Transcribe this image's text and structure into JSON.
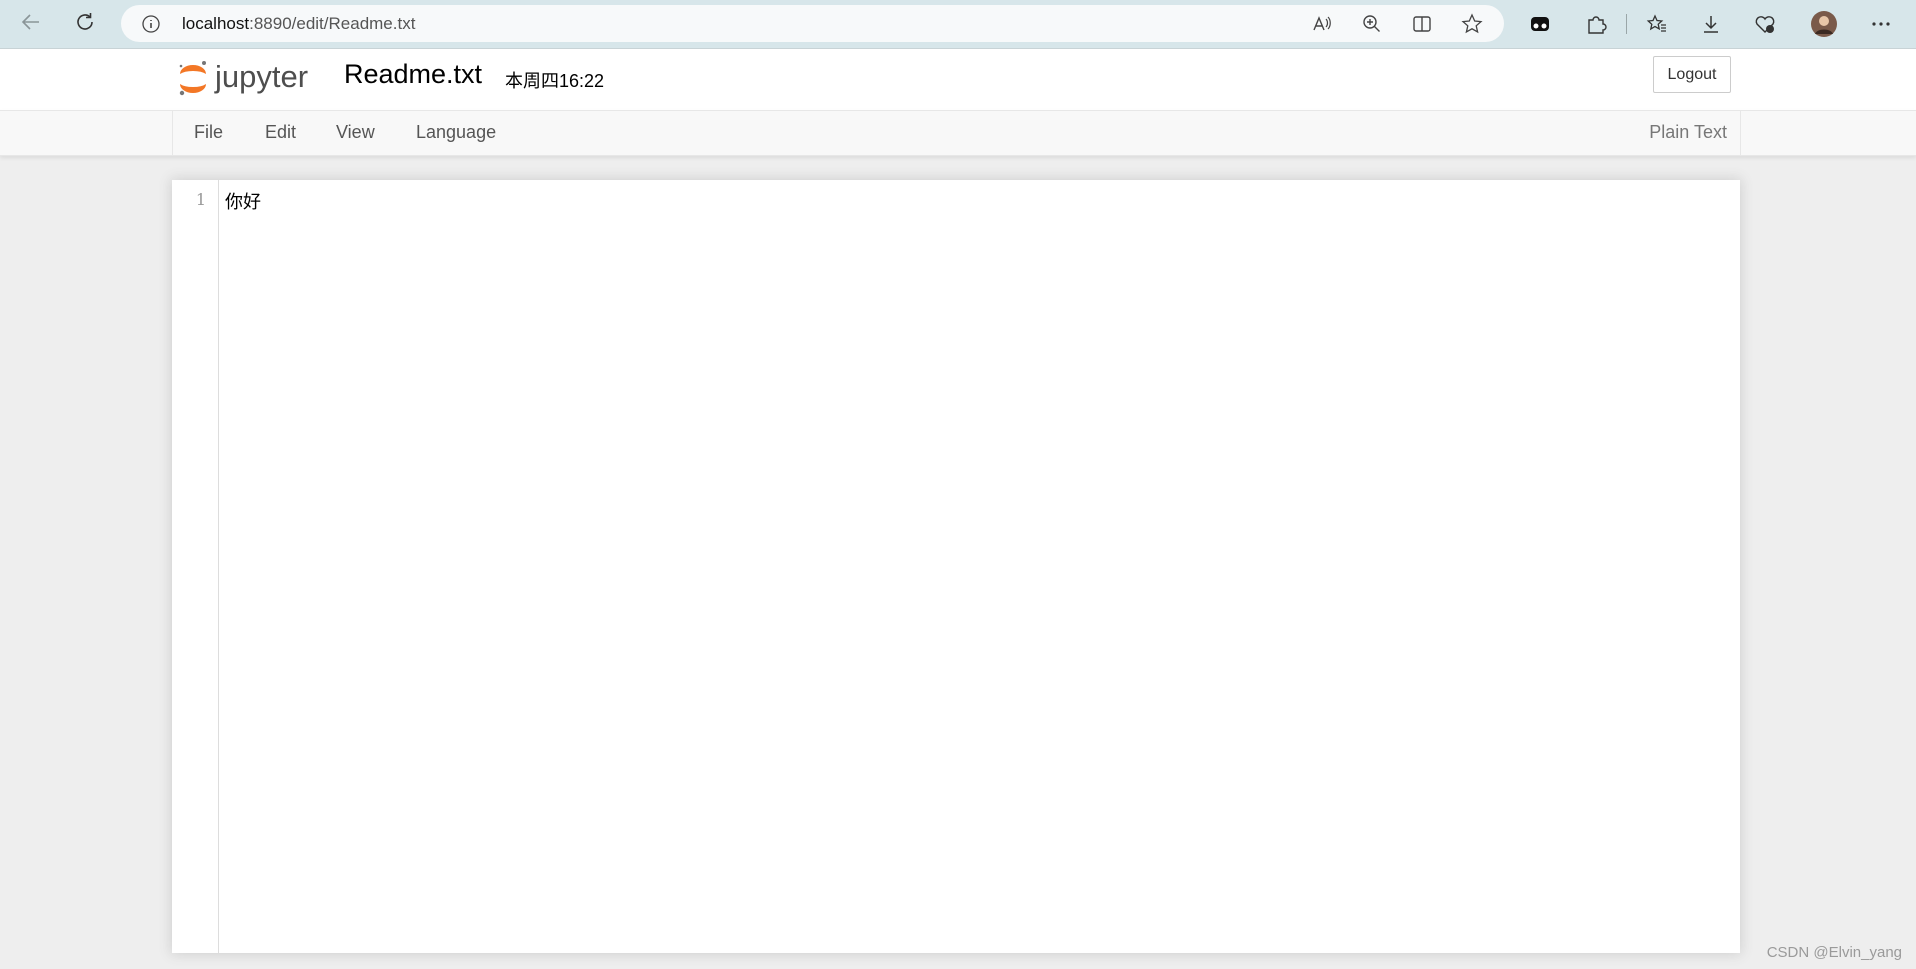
{
  "browser": {
    "url_host": "localhost",
    "url_path": ":8890/edit/Readme.txt"
  },
  "header": {
    "logo_text": "jupyter",
    "filename": "Readme.txt",
    "last_saved": "本周四16:22",
    "logout_label": "Logout"
  },
  "menubar": {
    "items": [
      "File",
      "Edit",
      "View",
      "Language"
    ],
    "mode": "Plain Text"
  },
  "editor": {
    "lines": [
      {
        "number": "1",
        "text": "你好"
      }
    ]
  },
  "watermark": "CSDN @Elvin_yang",
  "colors": {
    "jupyter_orange": "#f37726",
    "jupyter_gray": "#767677",
    "browser_bar": "#d7e6ea"
  }
}
